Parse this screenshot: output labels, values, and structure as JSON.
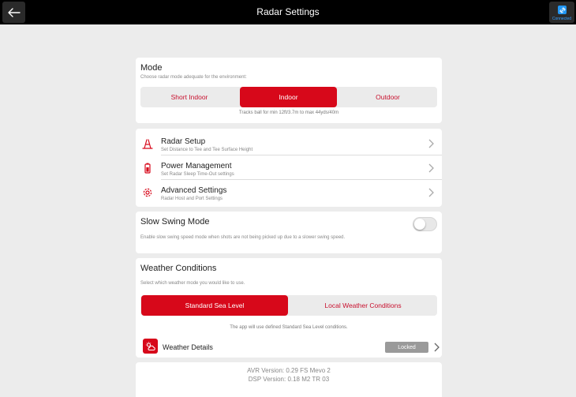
{
  "header": {
    "title": "Radar Settings",
    "connection_label": "Connected",
    "back_icon": "arrow-left-icon",
    "connection_icon": "link-icon"
  },
  "mode": {
    "title": "Mode",
    "subtitle": "Choose radar mode adequate for the environment:",
    "options": [
      "Short Indoor",
      "Indoor",
      "Outdoor"
    ],
    "selected": "Indoor",
    "hint": "Tracks ball for min 12ft/3.7m to max 44yds/40m"
  },
  "settings_list": {
    "items": [
      {
        "title": "Radar Setup",
        "subtitle": "Set Distance to Tee and Tee Surface Height",
        "icon": "radar-setup-icon"
      },
      {
        "title": "Power Management",
        "subtitle": "Set Radar Sleep Time-Out settings",
        "icon": "battery-icon"
      },
      {
        "title": "Advanced Settings",
        "subtitle": "Radar Host and Port Settings",
        "icon": "gear-icon"
      }
    ]
  },
  "slow_swing": {
    "title": "Slow Swing Mode",
    "description": "Enable slow swing speed mode when shots are not being picked up due to a slower swing speed.",
    "enabled": false
  },
  "weather": {
    "title": "Weather Conditions",
    "subtitle": "Select which weather mode you would like to use.",
    "options": [
      "Standard Sea Level",
      "Local Weather Conditions"
    ],
    "selected": "Standard Sea Level",
    "hint": "The app will use defined Standard Sea Level conditions.",
    "details_label": "Weather Details",
    "details_status": "Locked",
    "details_icon": "weather-icon"
  },
  "versions": {
    "avr": "AVR Version: 0.29 FS Mevo 2",
    "dsp": "DSP Version: 0.18   M2 TR 03"
  },
  "colors": {
    "accent": "#d7081a",
    "header_bg": "#000000",
    "page_bg": "#ececec",
    "connected": "#2196f3"
  }
}
